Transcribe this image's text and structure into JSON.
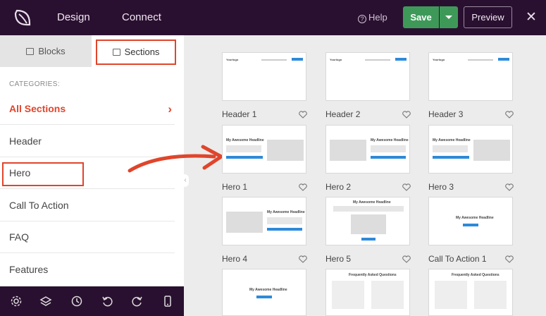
{
  "topbar": {
    "nav_design": "Design",
    "nav_connect": "Connect",
    "help": "Help",
    "save": "Save",
    "preview": "Preview"
  },
  "sidebar": {
    "tabs": [
      {
        "label": "Blocks"
      },
      {
        "label": "Sections"
      }
    ],
    "categories_label": "CATEGORIES:",
    "categories": [
      {
        "label": "All Sections"
      },
      {
        "label": "Header"
      },
      {
        "label": "Hero"
      },
      {
        "label": "Call To Action"
      },
      {
        "label": "FAQ"
      },
      {
        "label": "Features"
      }
    ]
  },
  "cards": [
    {
      "label": "Header 1"
    },
    {
      "label": "Header 2"
    },
    {
      "label": "Header 3"
    },
    {
      "label": "Hero 1"
    },
    {
      "label": "Hero 2"
    },
    {
      "label": "Hero 3"
    },
    {
      "label": "Hero 4"
    },
    {
      "label": "Hero 5"
    },
    {
      "label": "Call To Action 1"
    },
    {
      "label": ""
    },
    {
      "label": ""
    },
    {
      "label": ""
    }
  ],
  "thumbs": {
    "header_logo": "Yourlogo",
    "headline": "My Awesome Headline",
    "faq_title": "Frequently Asked Questions"
  },
  "colors": {
    "accent": "#e0452b",
    "dark": "#2a1030",
    "save": "#3e9959",
    "link": "#2e8ad8"
  }
}
